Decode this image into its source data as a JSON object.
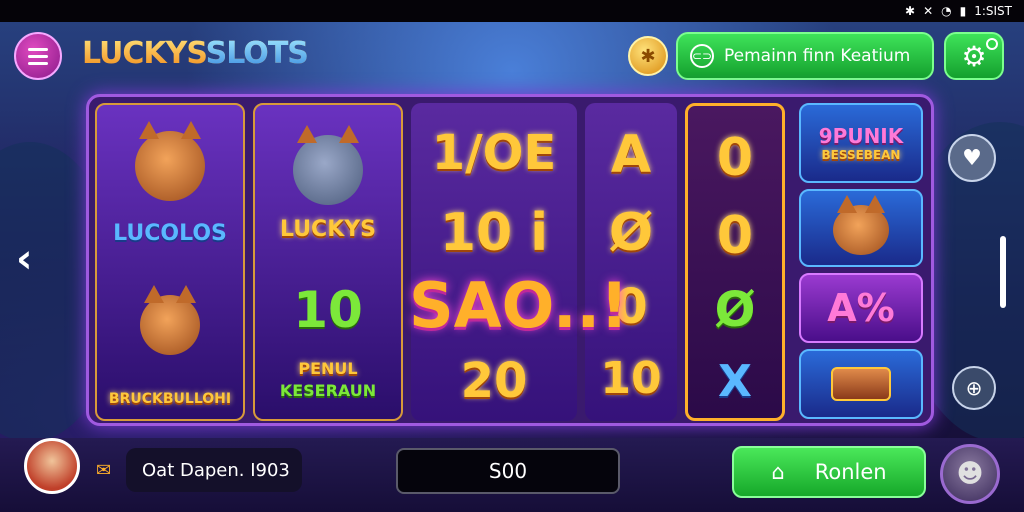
{
  "status_bar": {
    "icons": [
      "bluetooth-icon",
      "mute-icon",
      "wifi-icon",
      "signal-icon"
    ],
    "time": "1:SIST"
  },
  "header": {
    "logo_part1": "LUCKYS",
    "logo_part2": "SLOTS",
    "promo_label": "Pemainn finn Keatium",
    "colors": {
      "accent_green": "#2fd84a",
      "accent_gold": "#ffc83a",
      "accent_purple": "#8a1a8a"
    }
  },
  "reels": {
    "reel1": {
      "title": "LUCOLOS",
      "label": "BRUCKBULLOHI"
    },
    "reel2": {
      "title": "LUCKYS",
      "value": "10",
      "tag1": "PENUL",
      "tag2": "KESERAUN"
    },
    "reel3": {
      "top": "1/OE",
      "middle": "10 i",
      "bottom": "20"
    },
    "overlay": "SAO..!",
    "reel4": {
      "top": "A",
      "middle": "Ø",
      "third": "0",
      "bottom": "10"
    },
    "reel5": {
      "top": "0",
      "middle": "0",
      "third": "Ø",
      "bottom": "X"
    },
    "side": {
      "tile1_line1": "9PUNIK",
      "tile1_line2": "BESSEBEAN",
      "tile3": "A%"
    }
  },
  "bottom": {
    "player_name": "Oat Dapen. I903",
    "bet_value": "S00",
    "spin_label": "Ronlen"
  }
}
